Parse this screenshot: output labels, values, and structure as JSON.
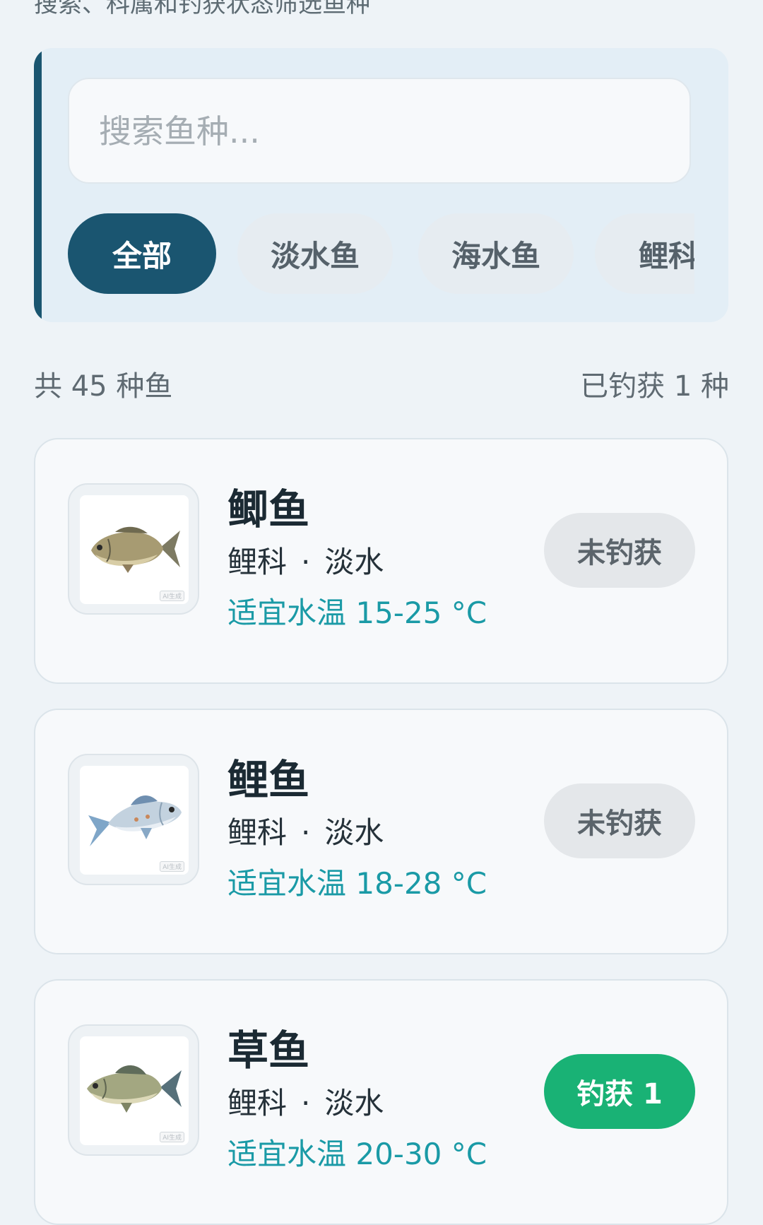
{
  "page": {
    "subtitle": "搜索、科属和钓获状态筛选鱼种"
  },
  "search": {
    "placeholder": "搜索鱼种..."
  },
  "filters": [
    {
      "label": "全部",
      "active": true
    },
    {
      "label": "淡水鱼",
      "active": false
    },
    {
      "label": "海水鱼",
      "active": false
    },
    {
      "label": "鲤科",
      "active": false
    }
  ],
  "summary": {
    "total": "共 45 种鱼",
    "caught": "已钓获 1 种"
  },
  "fish": [
    {
      "name": "鲫鱼",
      "family": "鲤科",
      "water": "淡水",
      "temp": "适宜水温 15-25 °C",
      "status": "未钓获",
      "caught": false,
      "icon": "crucian-carp-image"
    },
    {
      "name": "鲤鱼",
      "family": "鲤科",
      "water": "淡水",
      "temp": "适宜水温 18-28 °C",
      "status": "未钓获",
      "caught": false,
      "icon": "carp-image"
    },
    {
      "name": "草鱼",
      "family": "鲤科",
      "water": "淡水",
      "temp": "适宜水温 20-30 °C",
      "status": "钓获 1",
      "caught": true,
      "icon": "grass-carp-image"
    }
  ],
  "thumbnail_watermark": "AI生成",
  "colors": {
    "accent": "#1a5570",
    "temperature": "#1a9aa6",
    "caught": "#19b275",
    "not_caught_bg": "#e4e7ea"
  }
}
